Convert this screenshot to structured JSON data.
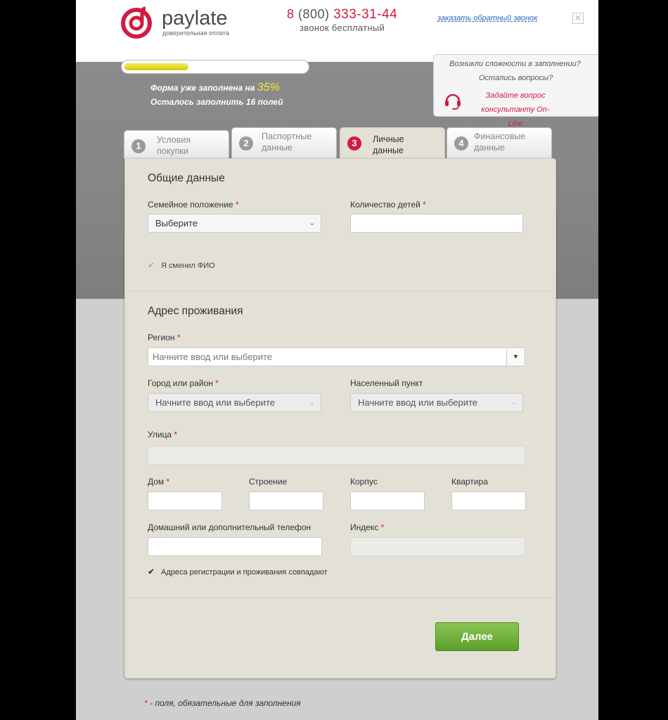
{
  "header": {
    "logo_text": "paylate",
    "logo_sub": "доверительная оплата",
    "phone_prefix": "8",
    "phone_code": "(800)",
    "phone_number": "333-31-44",
    "phone_sub": "звонок бесплатный",
    "callback_link": "заказать обратный звонок",
    "close_icon": "✕"
  },
  "progress": {
    "fill_fraction": 0.35,
    "line1_prefix": "Форма уже заполнена на",
    "percent": "35%",
    "line2": "Осталось заполнить 16 полей"
  },
  "help": {
    "q1": "Возникли сложности в заполнении?",
    "q2": "Остались вопросы?",
    "link": "Задайте вопрос консультанту On-Line",
    "icon": "headset-icon"
  },
  "tabs": [
    {
      "num": "1",
      "label": "Условия покупки",
      "active": false
    },
    {
      "num": "2",
      "label": "Паспортные данные",
      "active": false
    },
    {
      "num": "3",
      "label": "Личные данные",
      "active": true
    },
    {
      "num": "4",
      "label": "Финансовые данные",
      "active": false
    }
  ],
  "general": {
    "title": "Общие данные",
    "marital_label": "Семейное положение",
    "marital_value": "Выберите",
    "children_label": "Количество детей",
    "children_value": "",
    "changed_name_label": "Я сменил ФИО"
  },
  "address": {
    "title": "Адрес проживания",
    "region_label": "Регион",
    "region_placeholder": "Начните ввод или выберите",
    "city_label": "Город или район",
    "city_value": "Начните ввод или выберите",
    "settlement_label": "Населенный пункт",
    "settlement_value": "Начните ввод или выберите",
    "street_label": "Улица",
    "house_label": "Дом",
    "building_label": "Строение",
    "block_label": "Корпус",
    "apartment_label": "Квартира",
    "phone_label": "Домашний или дополнительный телефон",
    "index_label": "Индекс",
    "same_address_label": "Адреса регистрации и проживания совпадают"
  },
  "required_mark": "*",
  "next_button": "Далее",
  "footnote": "- поля, обязательные для заполнения",
  "colors": {
    "accent": "#d01c3f",
    "button_green": "#6aab35",
    "form_bg": "#e3e0d6"
  }
}
